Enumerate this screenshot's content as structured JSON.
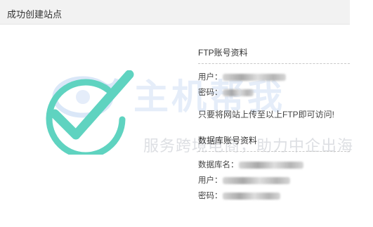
{
  "header": {
    "title": "成功创建站点"
  },
  "watermark": {
    "brand": "主机帮我",
    "slogan": "服务跨境电商，助力中企出海"
  },
  "ftp": {
    "section_title": "FTP账号资料",
    "user_label": "用户：",
    "user_value": "",
    "password_label": "密码：",
    "password_value": ""
  },
  "notice": "只要将网站上传至以上FTP即可访问!",
  "database": {
    "section_title": "数据库账号资料",
    "name_label": "数据库名：",
    "name_value": "",
    "user_label": "用户：",
    "user_value": "",
    "password_label": "密码：",
    "password_value": ""
  },
  "colors": {
    "check": "#5fd3c0",
    "header_bg": "#f2f2f2"
  },
  "icons": {
    "success": "check-circle-icon"
  }
}
